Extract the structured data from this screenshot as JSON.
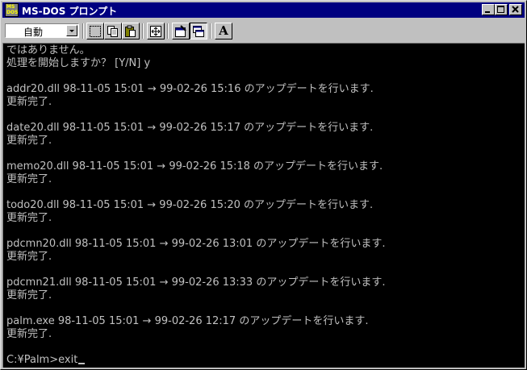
{
  "window": {
    "title": "MS-DOS プロンプト",
    "icon_text": "MS DOS"
  },
  "titlebar_buttons": [
    "minimize",
    "maximize",
    "close"
  ],
  "toolbar": {
    "font_size_value": "自動",
    "tools": [
      "mark-icon",
      "copy-icon",
      "paste-icon",
      "fullscreen-icon",
      "properties-icon",
      "background-icon",
      "font-icon"
    ],
    "font_button_label": "A"
  },
  "console": {
    "lines": [
      "ではありません。",
      "処理を開始しますか？ [Y/N] y",
      "",
      "addr20.dll 98-11-05 15:01 → 99-02-26 15:16 のアップデートを行います.",
      "更新完了.",
      "",
      "date20.dll 98-11-05 15:01 → 99-02-26 15:17 のアップデートを行います.",
      "更新完了.",
      "",
      "memo20.dll 98-11-05 15:01 → 99-02-26 15:18 のアップデートを行います.",
      "更新完了.",
      "",
      "todo20.dll 98-11-05 15:01 → 99-02-26 15:20 のアップデートを行います.",
      "更新完了.",
      "",
      "pdcmn20.dll 98-11-05 15:01 → 99-02-26 13:01 のアップデートを行います.",
      "更新完了.",
      "",
      "pdcmn21.dll 98-11-05 15:01 → 99-02-26 13:33 のアップデートを行います.",
      "更新完了.",
      "",
      "palm.exe 98-11-05 15:01 → 99-02-26 12:17 のアップデートを行います.",
      "更新完了.",
      "",
      "C:¥Palm>exit"
    ]
  }
}
